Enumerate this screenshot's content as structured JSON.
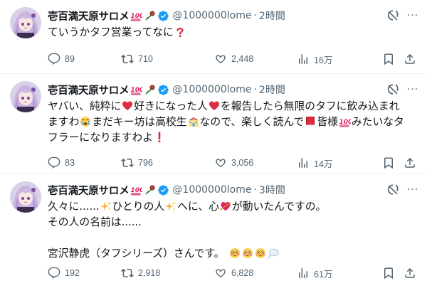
{
  "tweets": [
    {
      "display_name": "壱百満天原サロメ",
      "handle": "@1000000lome",
      "separator": "·",
      "time": "2時間",
      "text_lines": [
        "ていうかタフ営業ってなに"
      ],
      "replies": "89",
      "retweets": "710",
      "likes": "2,448",
      "views": "16万"
    },
    {
      "display_name": "壱百満天原サロメ",
      "handle": "@1000000lome",
      "separator": "·",
      "time": "2時間",
      "text": {
        "l1a": "ヤバい、純粋に",
        "l1b": "好きになった人",
        "l1c": "を報告したら無限のタフに飲み込まれ",
        "l2a": "ますわ",
        "l2b": "まだキー坊は高校生",
        "l2c": "なので、楽しく読んで",
        "l2d": "皆様",
        "l2e": "みたいなタ",
        "l3a": "フラーになりますわよ"
      },
      "replies": "83",
      "retweets": "796",
      "likes": "3,056",
      "views": "14万"
    },
    {
      "display_name": "壱百満天原サロメ",
      "handle": "@1000000lome",
      "separator": "·",
      "time": "3時間",
      "text": {
        "l1a": "久々に......",
        "l1b": "ひとりの人",
        "l1c": "へに、心",
        "l1d": "が動いたんですの。",
        "l2": "その人の名前は......",
        "l4": "宮沢静虎（タフシリーズ）さんです。"
      },
      "replies": "192",
      "retweets": "2,918",
      "likes": "6,828",
      "views": "61万"
    }
  ],
  "colors": {
    "verified": "#1d9bf0",
    "text": "#0f1419",
    "secondary": "#536471",
    "divider": "#eff3f4"
  },
  "icons": [
    "avatar",
    "100-emoji",
    "rose-emoji",
    "verified-badge",
    "grok-icon",
    "more-icon",
    "reply-icon",
    "retweet-icon",
    "like-icon",
    "views-icon",
    "bookmark-icon",
    "share-icon",
    "question-emoji",
    "heart-emoji",
    "crying-emoji",
    "school-emoji",
    "book-emoji",
    "exclamation-emoji",
    "sparkles-emoji",
    "heart-arrow-emoji",
    "flushed-emoji",
    "speech-balloon-emoji"
  ]
}
